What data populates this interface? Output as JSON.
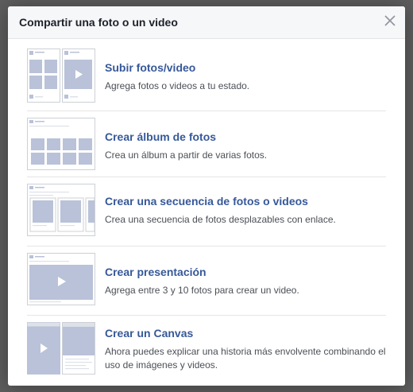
{
  "dialog": {
    "title": "Compartir una foto o un video",
    "close_icon": "close-icon"
  },
  "items": [
    {
      "title": "Subir fotos/video",
      "description": "Agrega fotos o videos a tu estado.",
      "icon": "upload-photos-icon"
    },
    {
      "title": "Crear álbum de fotos",
      "description": "Crea un álbum a partir de varias fotos.",
      "icon": "photo-album-icon"
    },
    {
      "title": "Crear una secuencia de fotos o videos",
      "description": "Crea una secuencia de fotos desplazables con enlace.",
      "icon": "carousel-icon"
    },
    {
      "title": "Crear presentación",
      "description": "Agrega entre 3 y 10 fotos para crear un video.",
      "icon": "slideshow-icon"
    },
    {
      "title": "Crear un Canvas",
      "description": "Ahora puedes explicar una historia más envolvente combinando el uso de imágenes y videos.",
      "icon": "canvas-icon"
    }
  ],
  "colors": {
    "link": "#365899",
    "text": "#4b4f56",
    "placeholder": "#b9c2d8",
    "overlay": "#5e5e5e"
  }
}
